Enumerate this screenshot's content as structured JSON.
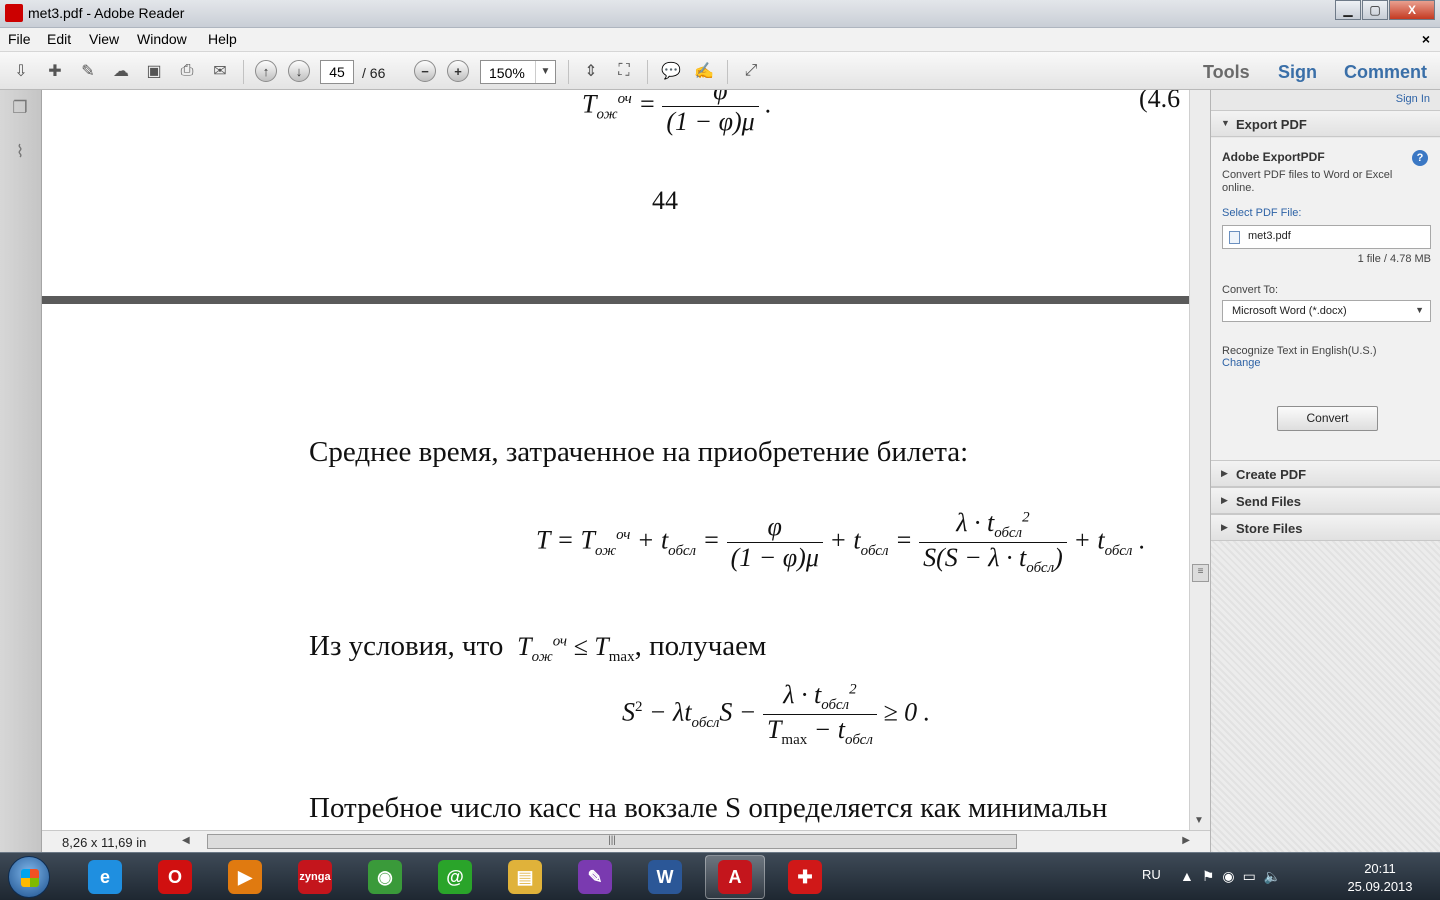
{
  "window": {
    "title": "met3.pdf - Adobe Reader",
    "controls": {
      "minimize": "▁",
      "maximize": "▢",
      "close": "X"
    }
  },
  "menu": {
    "items": [
      "File",
      "Edit",
      "View",
      "Window",
      "Help"
    ],
    "close_glyph": "×"
  },
  "toolbar": {
    "page_current": "45",
    "page_total": "/ 66",
    "zoom": "150%",
    "tabs": {
      "tools": "Tools",
      "sign": "Sign",
      "comment": "Comment"
    }
  },
  "document": {
    "prev_page_fragment_eqno": "(4.6",
    "prev_page_number": "44",
    "para1": "Среднее время, затраченное на приобретение билета:",
    "para2_prefix": "Из условия, что",
    "para2_suffix": ", получаем",
    "para3": "Потребное число касс на вокзале S определяется как минимальн"
  },
  "statusbar": {
    "dimensions": "8,26 x 11,69 in"
  },
  "right_panel": {
    "sign_in": "Sign In",
    "export_header": "Export PDF",
    "export_title": "Adobe ExportPDF",
    "export_desc": "Convert PDF files to Word or Excel online.",
    "select_label": "Select PDF File:",
    "file_name": "met3.pdf",
    "file_info": "1 file / 4.78 MB",
    "convert_to_label": "Convert To:",
    "convert_to_value": "Microsoft Word (*.docx)",
    "recognize_text": "Recognize Text in English(U.S.)",
    "change_link": "Change",
    "convert_button": "Convert",
    "sections": [
      "Create PDF",
      "Send Files",
      "Store Files"
    ]
  },
  "taskbar": {
    "language": "RU",
    "time": "20:11",
    "date": "25.09.2013",
    "apps": [
      {
        "name": "internet-explorer",
        "glyph": "e",
        "color": "#1f8fe0"
      },
      {
        "name": "opera",
        "glyph": "O",
        "color": "#d01010"
      },
      {
        "name": "media-player",
        "glyph": "▶",
        "color": "#e07a10"
      },
      {
        "name": "zynga",
        "glyph": "zynga",
        "color": "#c4151c"
      },
      {
        "name": "chrome",
        "glyph": "◉",
        "color": "#3a9a3a"
      },
      {
        "name": "mail-agent",
        "glyph": "@",
        "color": "#2aa42a"
      },
      {
        "name": "file-explorer",
        "glyph": "▤",
        "color": "#e0b23a"
      },
      {
        "name": "onenote",
        "glyph": "✎",
        "color": "#7a3ab0"
      },
      {
        "name": "word",
        "glyph": "W",
        "color": "#2b5797"
      },
      {
        "name": "adobe-reader",
        "glyph": "A",
        "color": "#c4151c"
      },
      {
        "name": "rescue-app",
        "glyph": "✚",
        "color": "#d01818"
      }
    ]
  }
}
